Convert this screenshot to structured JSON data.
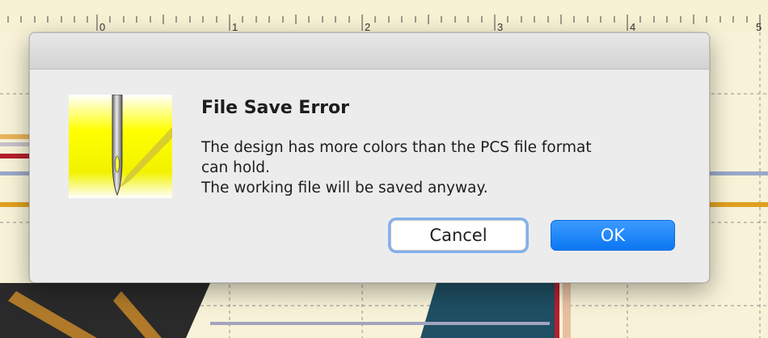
{
  "ruler": {
    "labels": [
      "0",
      "1",
      "2",
      "3",
      "4",
      "5"
    ]
  },
  "dialog": {
    "title": "File Save Error",
    "message_lines": [
      "The design has more colors than the PCS file format",
      "can hold.",
      "The working file will be saved anyway."
    ],
    "icon": "sewing-needle-icon",
    "buttons": {
      "cancel": "Cancel",
      "ok": "OK"
    }
  },
  "colors": {
    "accent": "#0a77f2",
    "focus_ring": "#7fb0ef",
    "canvas_background": "#f7f2d6",
    "icon_yellow": "#ffff00"
  }
}
